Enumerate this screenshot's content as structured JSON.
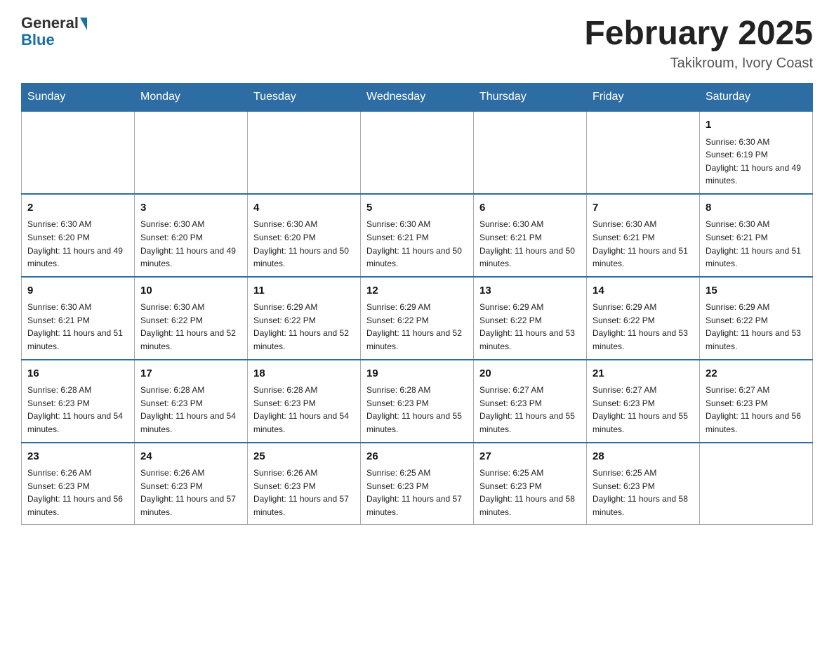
{
  "header": {
    "logo_general": "General",
    "logo_blue": "Blue",
    "month_title": "February 2025",
    "location": "Takikroum, Ivory Coast"
  },
  "days_of_week": [
    "Sunday",
    "Monday",
    "Tuesday",
    "Wednesday",
    "Thursday",
    "Friday",
    "Saturday"
  ],
  "weeks": [
    [
      {
        "day": "",
        "info": ""
      },
      {
        "day": "",
        "info": ""
      },
      {
        "day": "",
        "info": ""
      },
      {
        "day": "",
        "info": ""
      },
      {
        "day": "",
        "info": ""
      },
      {
        "day": "",
        "info": ""
      },
      {
        "day": "1",
        "info": "Sunrise: 6:30 AM\nSunset: 6:19 PM\nDaylight: 11 hours and 49 minutes."
      }
    ],
    [
      {
        "day": "2",
        "info": "Sunrise: 6:30 AM\nSunset: 6:20 PM\nDaylight: 11 hours and 49 minutes."
      },
      {
        "day": "3",
        "info": "Sunrise: 6:30 AM\nSunset: 6:20 PM\nDaylight: 11 hours and 49 minutes."
      },
      {
        "day": "4",
        "info": "Sunrise: 6:30 AM\nSunset: 6:20 PM\nDaylight: 11 hours and 50 minutes."
      },
      {
        "day": "5",
        "info": "Sunrise: 6:30 AM\nSunset: 6:21 PM\nDaylight: 11 hours and 50 minutes."
      },
      {
        "day": "6",
        "info": "Sunrise: 6:30 AM\nSunset: 6:21 PM\nDaylight: 11 hours and 50 minutes."
      },
      {
        "day": "7",
        "info": "Sunrise: 6:30 AM\nSunset: 6:21 PM\nDaylight: 11 hours and 51 minutes."
      },
      {
        "day": "8",
        "info": "Sunrise: 6:30 AM\nSunset: 6:21 PM\nDaylight: 11 hours and 51 minutes."
      }
    ],
    [
      {
        "day": "9",
        "info": "Sunrise: 6:30 AM\nSunset: 6:21 PM\nDaylight: 11 hours and 51 minutes."
      },
      {
        "day": "10",
        "info": "Sunrise: 6:30 AM\nSunset: 6:22 PM\nDaylight: 11 hours and 52 minutes."
      },
      {
        "day": "11",
        "info": "Sunrise: 6:29 AM\nSunset: 6:22 PM\nDaylight: 11 hours and 52 minutes."
      },
      {
        "day": "12",
        "info": "Sunrise: 6:29 AM\nSunset: 6:22 PM\nDaylight: 11 hours and 52 minutes."
      },
      {
        "day": "13",
        "info": "Sunrise: 6:29 AM\nSunset: 6:22 PM\nDaylight: 11 hours and 53 minutes."
      },
      {
        "day": "14",
        "info": "Sunrise: 6:29 AM\nSunset: 6:22 PM\nDaylight: 11 hours and 53 minutes."
      },
      {
        "day": "15",
        "info": "Sunrise: 6:29 AM\nSunset: 6:22 PM\nDaylight: 11 hours and 53 minutes."
      }
    ],
    [
      {
        "day": "16",
        "info": "Sunrise: 6:28 AM\nSunset: 6:23 PM\nDaylight: 11 hours and 54 minutes."
      },
      {
        "day": "17",
        "info": "Sunrise: 6:28 AM\nSunset: 6:23 PM\nDaylight: 11 hours and 54 minutes."
      },
      {
        "day": "18",
        "info": "Sunrise: 6:28 AM\nSunset: 6:23 PM\nDaylight: 11 hours and 54 minutes."
      },
      {
        "day": "19",
        "info": "Sunrise: 6:28 AM\nSunset: 6:23 PM\nDaylight: 11 hours and 55 minutes."
      },
      {
        "day": "20",
        "info": "Sunrise: 6:27 AM\nSunset: 6:23 PM\nDaylight: 11 hours and 55 minutes."
      },
      {
        "day": "21",
        "info": "Sunrise: 6:27 AM\nSunset: 6:23 PM\nDaylight: 11 hours and 55 minutes."
      },
      {
        "day": "22",
        "info": "Sunrise: 6:27 AM\nSunset: 6:23 PM\nDaylight: 11 hours and 56 minutes."
      }
    ],
    [
      {
        "day": "23",
        "info": "Sunrise: 6:26 AM\nSunset: 6:23 PM\nDaylight: 11 hours and 56 minutes."
      },
      {
        "day": "24",
        "info": "Sunrise: 6:26 AM\nSunset: 6:23 PM\nDaylight: 11 hours and 57 minutes."
      },
      {
        "day": "25",
        "info": "Sunrise: 6:26 AM\nSunset: 6:23 PM\nDaylight: 11 hours and 57 minutes."
      },
      {
        "day": "26",
        "info": "Sunrise: 6:25 AM\nSunset: 6:23 PM\nDaylight: 11 hours and 57 minutes."
      },
      {
        "day": "27",
        "info": "Sunrise: 6:25 AM\nSunset: 6:23 PM\nDaylight: 11 hours and 58 minutes."
      },
      {
        "day": "28",
        "info": "Sunrise: 6:25 AM\nSunset: 6:23 PM\nDaylight: 11 hours and 58 minutes."
      },
      {
        "day": "",
        "info": ""
      }
    ]
  ]
}
